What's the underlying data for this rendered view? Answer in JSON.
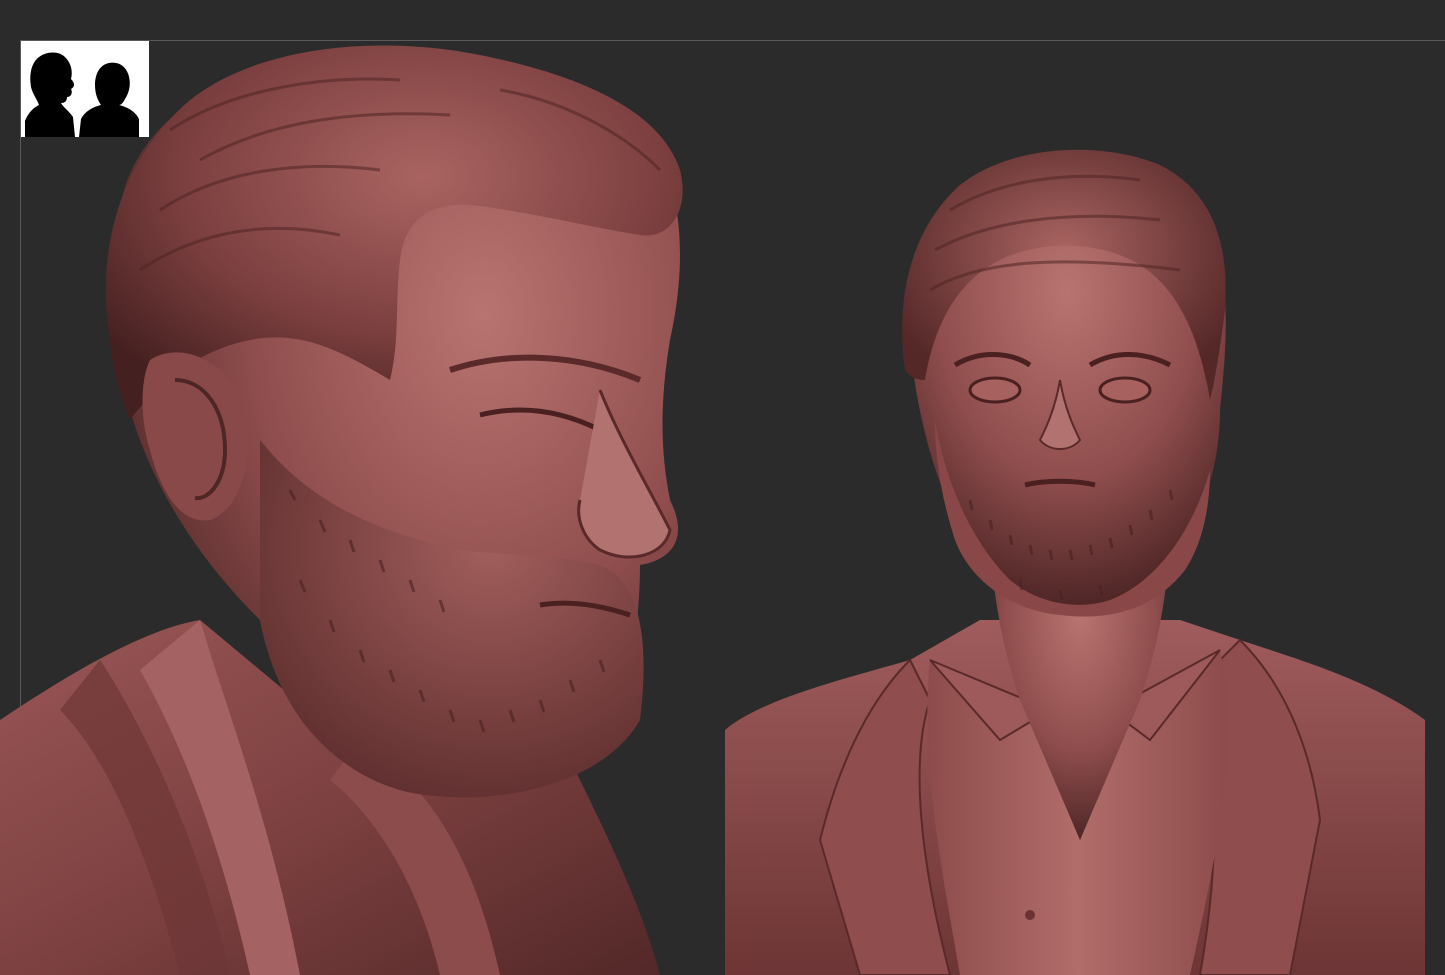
{
  "viewport": {
    "background_color": "#2b2b2b",
    "frame_color": "#5a5a5a"
  },
  "navigation_thumbnail": {
    "icon": "silhouette-navigator-icon",
    "background_color": "#ffffff",
    "silhouette_color": "#000000"
  },
  "models": [
    {
      "name": "bust-three-quarter-view",
      "view": "three-quarter-left"
    },
    {
      "name": "bust-front-view",
      "view": "front"
    }
  ],
  "material": {
    "base_color": "#9a5656",
    "shadow_color": "#4f2626",
    "highlight_color": "#c98a86"
  }
}
